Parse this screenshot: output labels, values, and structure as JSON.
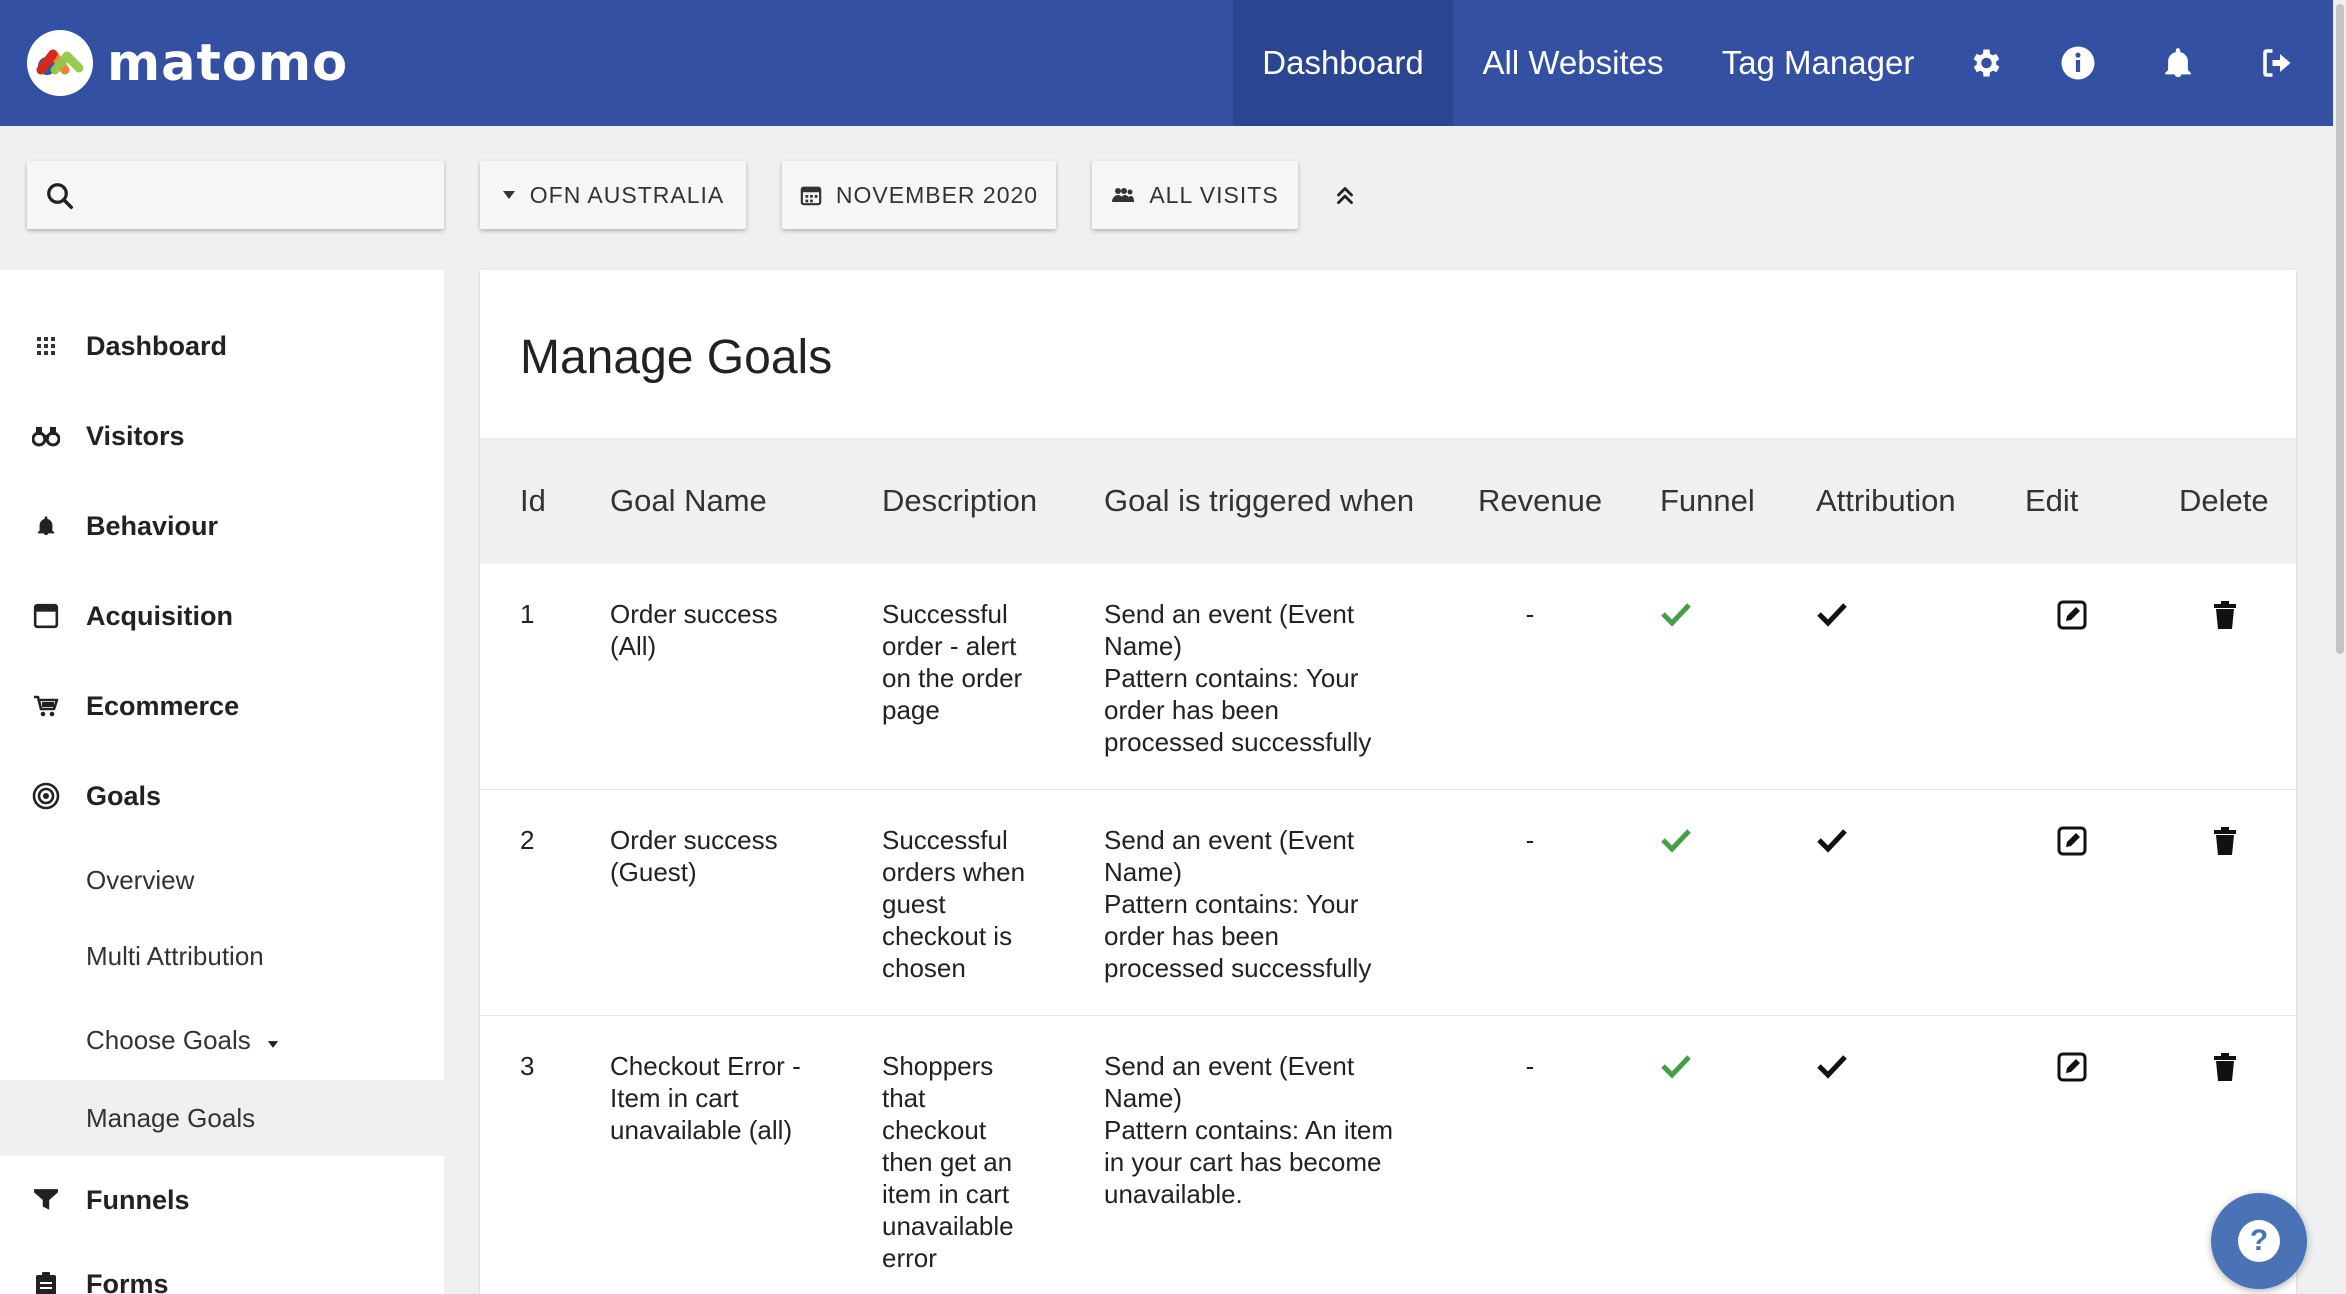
{
  "app": {
    "name": "matomo"
  },
  "topnav": {
    "dashboard": "Dashboard",
    "all_websites": "All Websites",
    "tag_manager": "Tag Manager"
  },
  "topicons": [
    "gear-icon",
    "info-icon",
    "bell-icon",
    "logout-icon"
  ],
  "controls": {
    "search_placeholder": "",
    "site": "OFN AUSTRALIA",
    "period": "NOVEMBER 2020",
    "segment": "ALL VISITS"
  },
  "sidebar": {
    "items": [
      {
        "label": "Dashboard",
        "icon": "grid-icon"
      },
      {
        "label": "Visitors",
        "icon": "binoculars-icon"
      },
      {
        "label": "Behaviour",
        "icon": "bell-icon"
      },
      {
        "label": "Acquisition",
        "icon": "window-icon"
      },
      {
        "label": "Ecommerce",
        "icon": "cart-icon"
      },
      {
        "label": "Goals",
        "icon": "target-icon"
      }
    ],
    "goals_sub": [
      {
        "label": "Overview"
      },
      {
        "label": "Multi Attribution"
      },
      {
        "label": "Choose Goals"
      },
      {
        "label": "Manage Goals"
      }
    ],
    "after": [
      {
        "label": "Funnels",
        "icon": "funnel-icon"
      },
      {
        "label": "Forms",
        "icon": "clipboard-icon"
      }
    ]
  },
  "page": {
    "title": "Manage Goals"
  },
  "table": {
    "headers": {
      "id": "Id",
      "name": "Goal Name",
      "description": "Description",
      "trigger": "Goal is triggered when",
      "revenue": "Revenue",
      "funnel": "Funnel",
      "attribution": "Attribution",
      "edit": "Edit",
      "delete": "Delete"
    },
    "rows": [
      {
        "id": "1",
        "name": [
          "Order success",
          "(All)"
        ],
        "description": [
          "Successful",
          "order - alert",
          "on the order",
          "page"
        ],
        "trigger": [
          "Send an event (Event",
          "Name)",
          "Pattern contains: Your",
          "order has been",
          "processed successfully"
        ],
        "revenue": "-"
      },
      {
        "id": "2",
        "name": [
          "Order success",
          "(Guest)"
        ],
        "description": [
          "Successful",
          "orders when",
          "guest",
          "checkout is",
          "chosen"
        ],
        "trigger": [
          "Send an event (Event",
          "Name)",
          "Pattern contains: Your",
          "order has been",
          "processed successfully"
        ],
        "revenue": "-"
      },
      {
        "id": "3",
        "name": [
          "Checkout Error -",
          "Item in cart",
          "unavailable (all)"
        ],
        "description": [
          "Shoppers",
          "that",
          "checkout",
          "then get an",
          "item in cart",
          "unavailable",
          "error"
        ],
        "trigger": [
          "Send an event (Event",
          "Name)",
          "Pattern contains: An item",
          "in your cart has become",
          "unavailable."
        ],
        "revenue": "-"
      }
    ]
  },
  "colors": {
    "topbar": "#3450a3",
    "funnel_check": "#43a047",
    "help": "#4a72b7"
  },
  "help": {
    "label": "?"
  }
}
